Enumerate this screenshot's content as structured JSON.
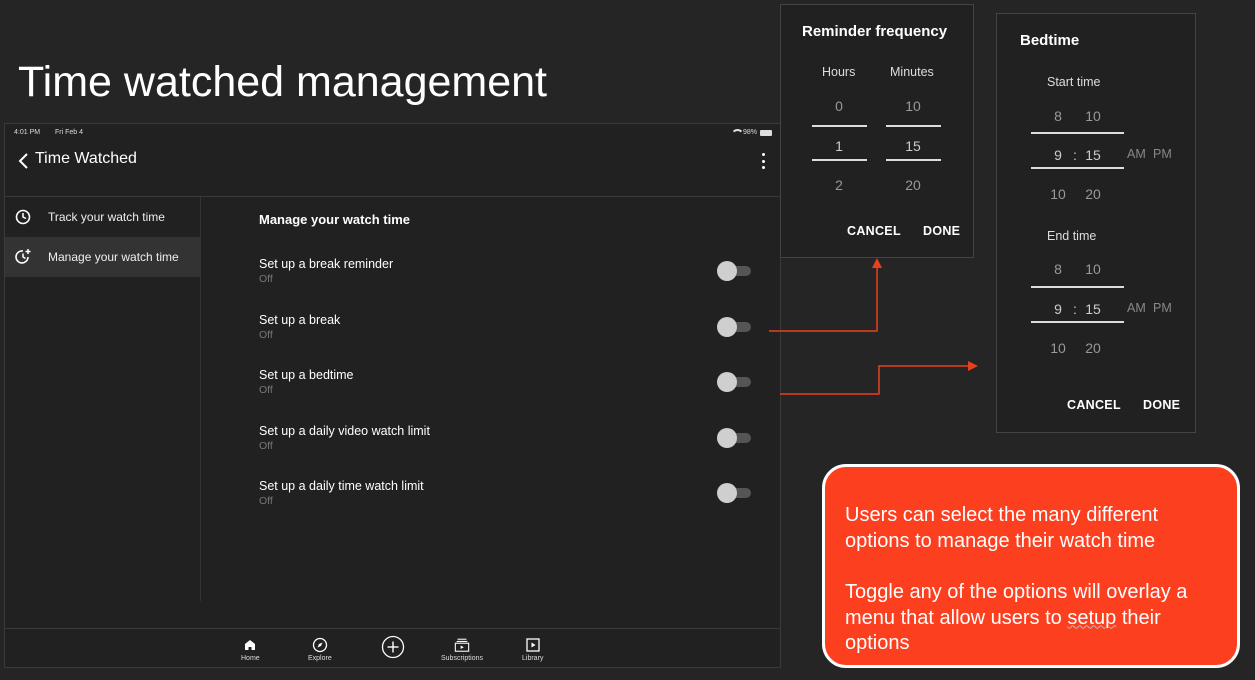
{
  "slide": {
    "title": "Time watched management"
  },
  "status_bar": {
    "time": "4:01 PM",
    "date": "Fri Feb 4",
    "battery": "98%"
  },
  "app_bar": {
    "title": "Time Watched",
    "back_icon": "chevron-left-icon",
    "more_icon": "more-vert-icon"
  },
  "sidebar": {
    "items": [
      {
        "label": "Track your watch time",
        "icon": "clock-icon",
        "active": false
      },
      {
        "label": "Manage your watch time",
        "icon": "timer-add-icon",
        "active": true
      }
    ]
  },
  "main": {
    "title": "Manage your watch time",
    "settings": [
      {
        "label": "Set up a break reminder",
        "status": "Off"
      },
      {
        "label": "Set up a break",
        "status": "Off"
      },
      {
        "label": "Set up a bedtime",
        "status": "Off"
      },
      {
        "label": "Set up a daily video watch limit",
        "status": "Off"
      },
      {
        "label": "Set up a daily time watch limit",
        "status": "Off"
      }
    ]
  },
  "bottom_nav": {
    "items": [
      {
        "label": "Home",
        "icon": "home-icon"
      },
      {
        "label": "Explore",
        "icon": "compass-icon"
      },
      {
        "label": "",
        "icon": "add-circle-icon"
      },
      {
        "label": "Subscriptions",
        "icon": "subscriptions-icon"
      },
      {
        "label": "Library",
        "icon": "library-icon"
      }
    ]
  },
  "reminder_dialog": {
    "title": "Reminder frequency",
    "hours_label": "Hours",
    "minutes_label": "Minutes",
    "hours": [
      "0",
      "1",
      "2"
    ],
    "minutes": [
      "10",
      "15",
      "20"
    ],
    "cancel": "CANCEL",
    "done": "DONE"
  },
  "bedtime_dialog": {
    "title": "Bedtime",
    "start_label": "Start time",
    "end_label": "End time",
    "start": {
      "hours": [
        "8",
        "9",
        "10"
      ],
      "minutes": [
        "10",
        "15",
        "20"
      ]
    },
    "end": {
      "hours": [
        "8",
        "9",
        "10"
      ],
      "minutes": [
        "10",
        "15",
        "20"
      ]
    },
    "separator": ":",
    "am": "AM",
    "pm": "PM",
    "cancel": "CANCEL",
    "done": "DONE"
  },
  "note": {
    "paragraph1": "Users can select the many different options to manage their watch time",
    "p2_before": "Toggle any of the options will overlay a menu that allow users to ",
    "p2_squiggle": "setup",
    "p2_after": " their options"
  },
  "colors": {
    "background": "#252525",
    "note": "#fb3f1f",
    "arrow": "#e8401c",
    "toggle_knob": "#cfcfcf"
  }
}
